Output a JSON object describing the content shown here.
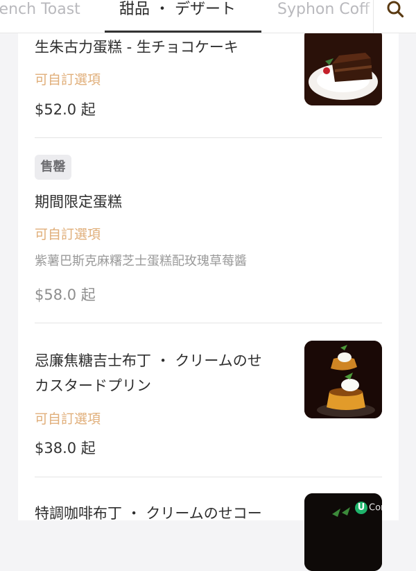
{
  "tabs": [
    {
      "label": "rench Toast",
      "state": "inactive"
    },
    {
      "label": "甜品 ・ デザート",
      "state": "active"
    },
    {
      "label": "Syphon Coff",
      "state": "inactive"
    }
  ],
  "search": {
    "icon": "search-icon"
  },
  "items": [
    {
      "name_lines": [
        "生朱古力蛋糕 - 生チョコケーキ"
      ],
      "custom_label": "可自訂選項",
      "price": "$52.0 起",
      "image": "chocolate-cake-image"
    },
    {
      "badge": "售罄",
      "name_lines": [
        "期間限定蛋糕"
      ],
      "custom_label": "可自訂選項",
      "description": "紫薯巴斯克麻糬芝士蛋糕配玫瑰草莓醬",
      "price": "$58.0 起"
    },
    {
      "name_lines": [
        "忌廉焦糖吉士布丁 ・ クリームのせ",
        "カスタードプリン"
      ],
      "custom_label": "可自訂選項",
      "price": "$38.0 起",
      "image": "custard-pudding-image"
    },
    {
      "name_lines": [
        "特調咖啡布丁 ・ クリームのせコー"
      ],
      "image": "coffee-pudding-image"
    }
  ],
  "watermark": {
    "logo_letter": "U",
    "text": "Com"
  },
  "colors": {
    "custom_label": "#e0ae79",
    "soldout_badge_bg": "#ececef",
    "active_tab_underline": "#333333"
  }
}
